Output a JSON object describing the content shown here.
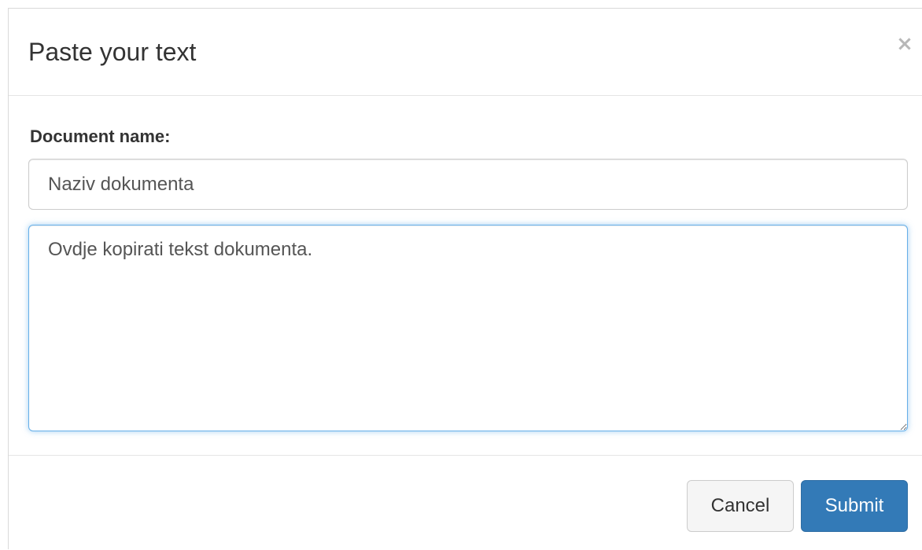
{
  "modal": {
    "title": "Paste your text",
    "close_label": "×"
  },
  "form": {
    "name_label": "Document name:",
    "name_placeholder": "Naziv dokumenta",
    "text_value": "Ovdje kopirati tekst dokumenta."
  },
  "footer": {
    "cancel_label": "Cancel",
    "submit_label": "Submit"
  },
  "colors": {
    "primary": "#337ab7",
    "focus_border": "#66afe9"
  }
}
